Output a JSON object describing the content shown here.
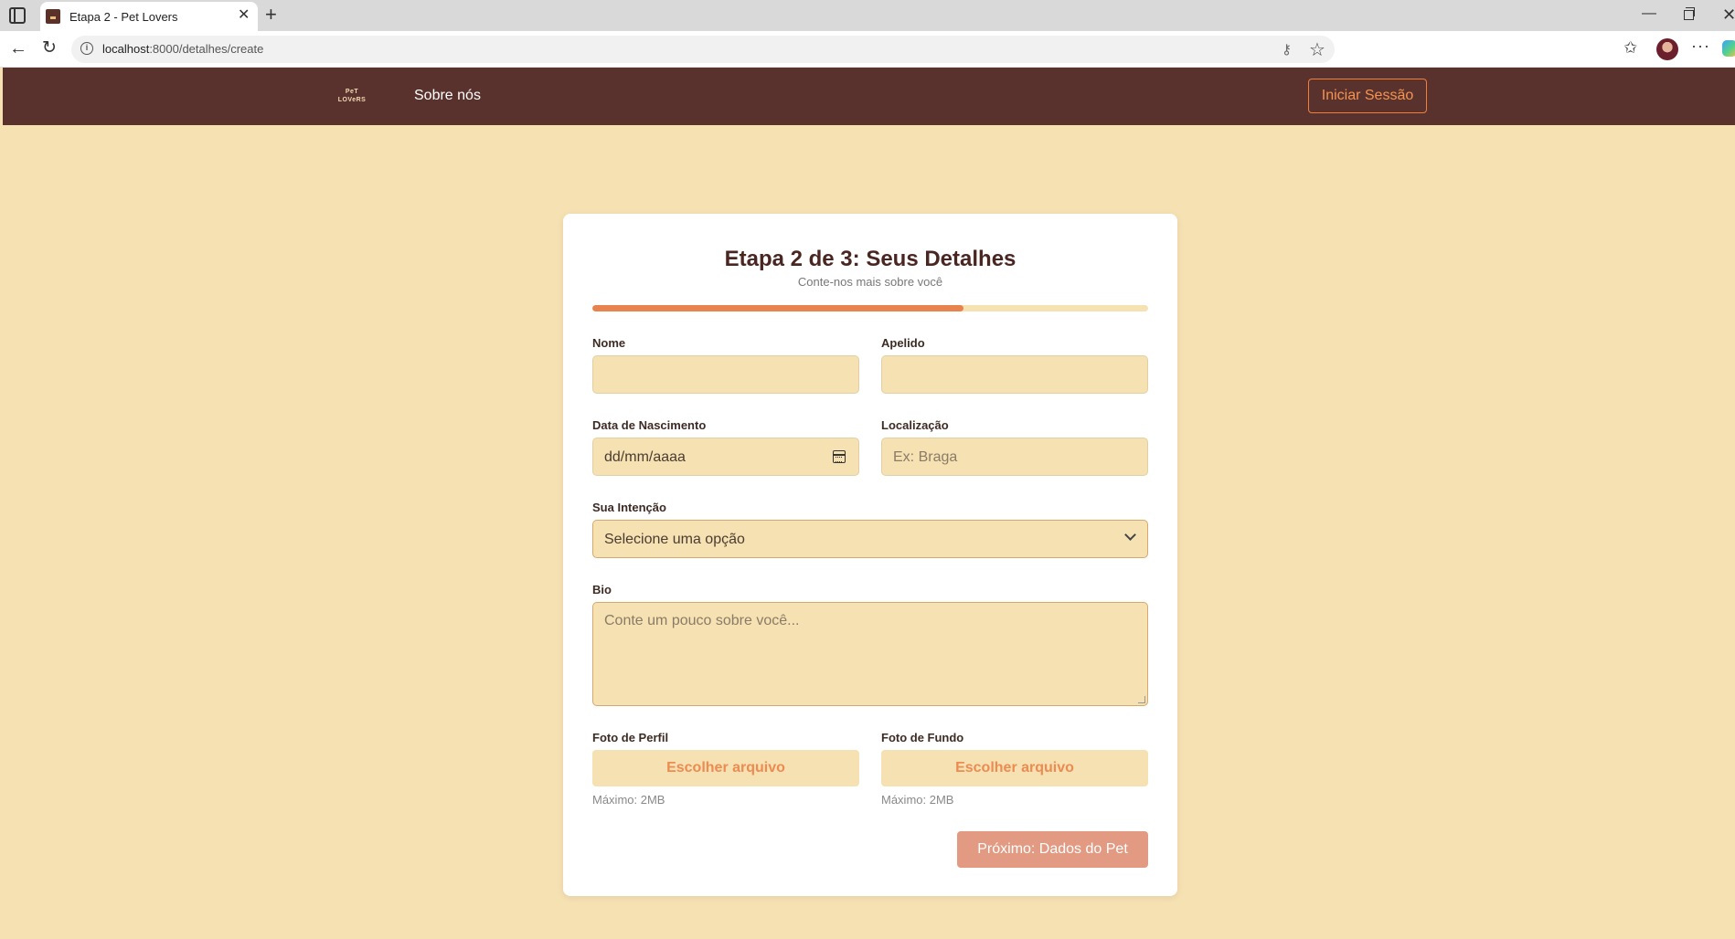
{
  "browser": {
    "tab_title": "Etapa 2 - Pet Lovers",
    "tab_close": "✕",
    "new_tab": "+",
    "url_host": "localhost",
    "url_path": ":8000/detalhes/create",
    "window_min": "—",
    "window_close": "✕"
  },
  "header": {
    "logo_line1": "PeT",
    "logo_line2": "LOVeRS",
    "nav_about": "Sobre nós",
    "login_button": "Iniciar Sessão"
  },
  "form": {
    "title": "Etapa 2 de 3: Seus Detalhes",
    "subtitle": "Conte-nos mais sobre você",
    "progress": 0.667,
    "fields": {
      "first_name_label": "Nome",
      "first_name_value": "",
      "last_name_label": "Apelido",
      "last_name_value": "",
      "birthdate_label": "Data de Nascimento",
      "birthdate_placeholder": "dd/mm/aaaa",
      "location_label": "Localização",
      "location_placeholder": "Ex: Braga",
      "intent_label": "Sua Intenção",
      "intent_selected": "Selecione uma opção",
      "bio_label": "Bio",
      "bio_placeholder": "Conte um pouco sobre você...",
      "profile_photo_label": "Foto de Perfil",
      "profile_photo_button": "Escolher arquivo",
      "profile_photo_hint": "Máximo: 2MB",
      "cover_photo_label": "Foto de Fundo",
      "cover_photo_button": "Escolher arquivo",
      "cover_photo_hint": "Máximo: 2MB"
    },
    "next_button": "Próximo: Dados do Pet"
  },
  "colors": {
    "page_bg": "#f6e1b3",
    "header_bg": "#5a322d",
    "accent": "#e8834d",
    "next_button_bg": "#e29a82"
  }
}
